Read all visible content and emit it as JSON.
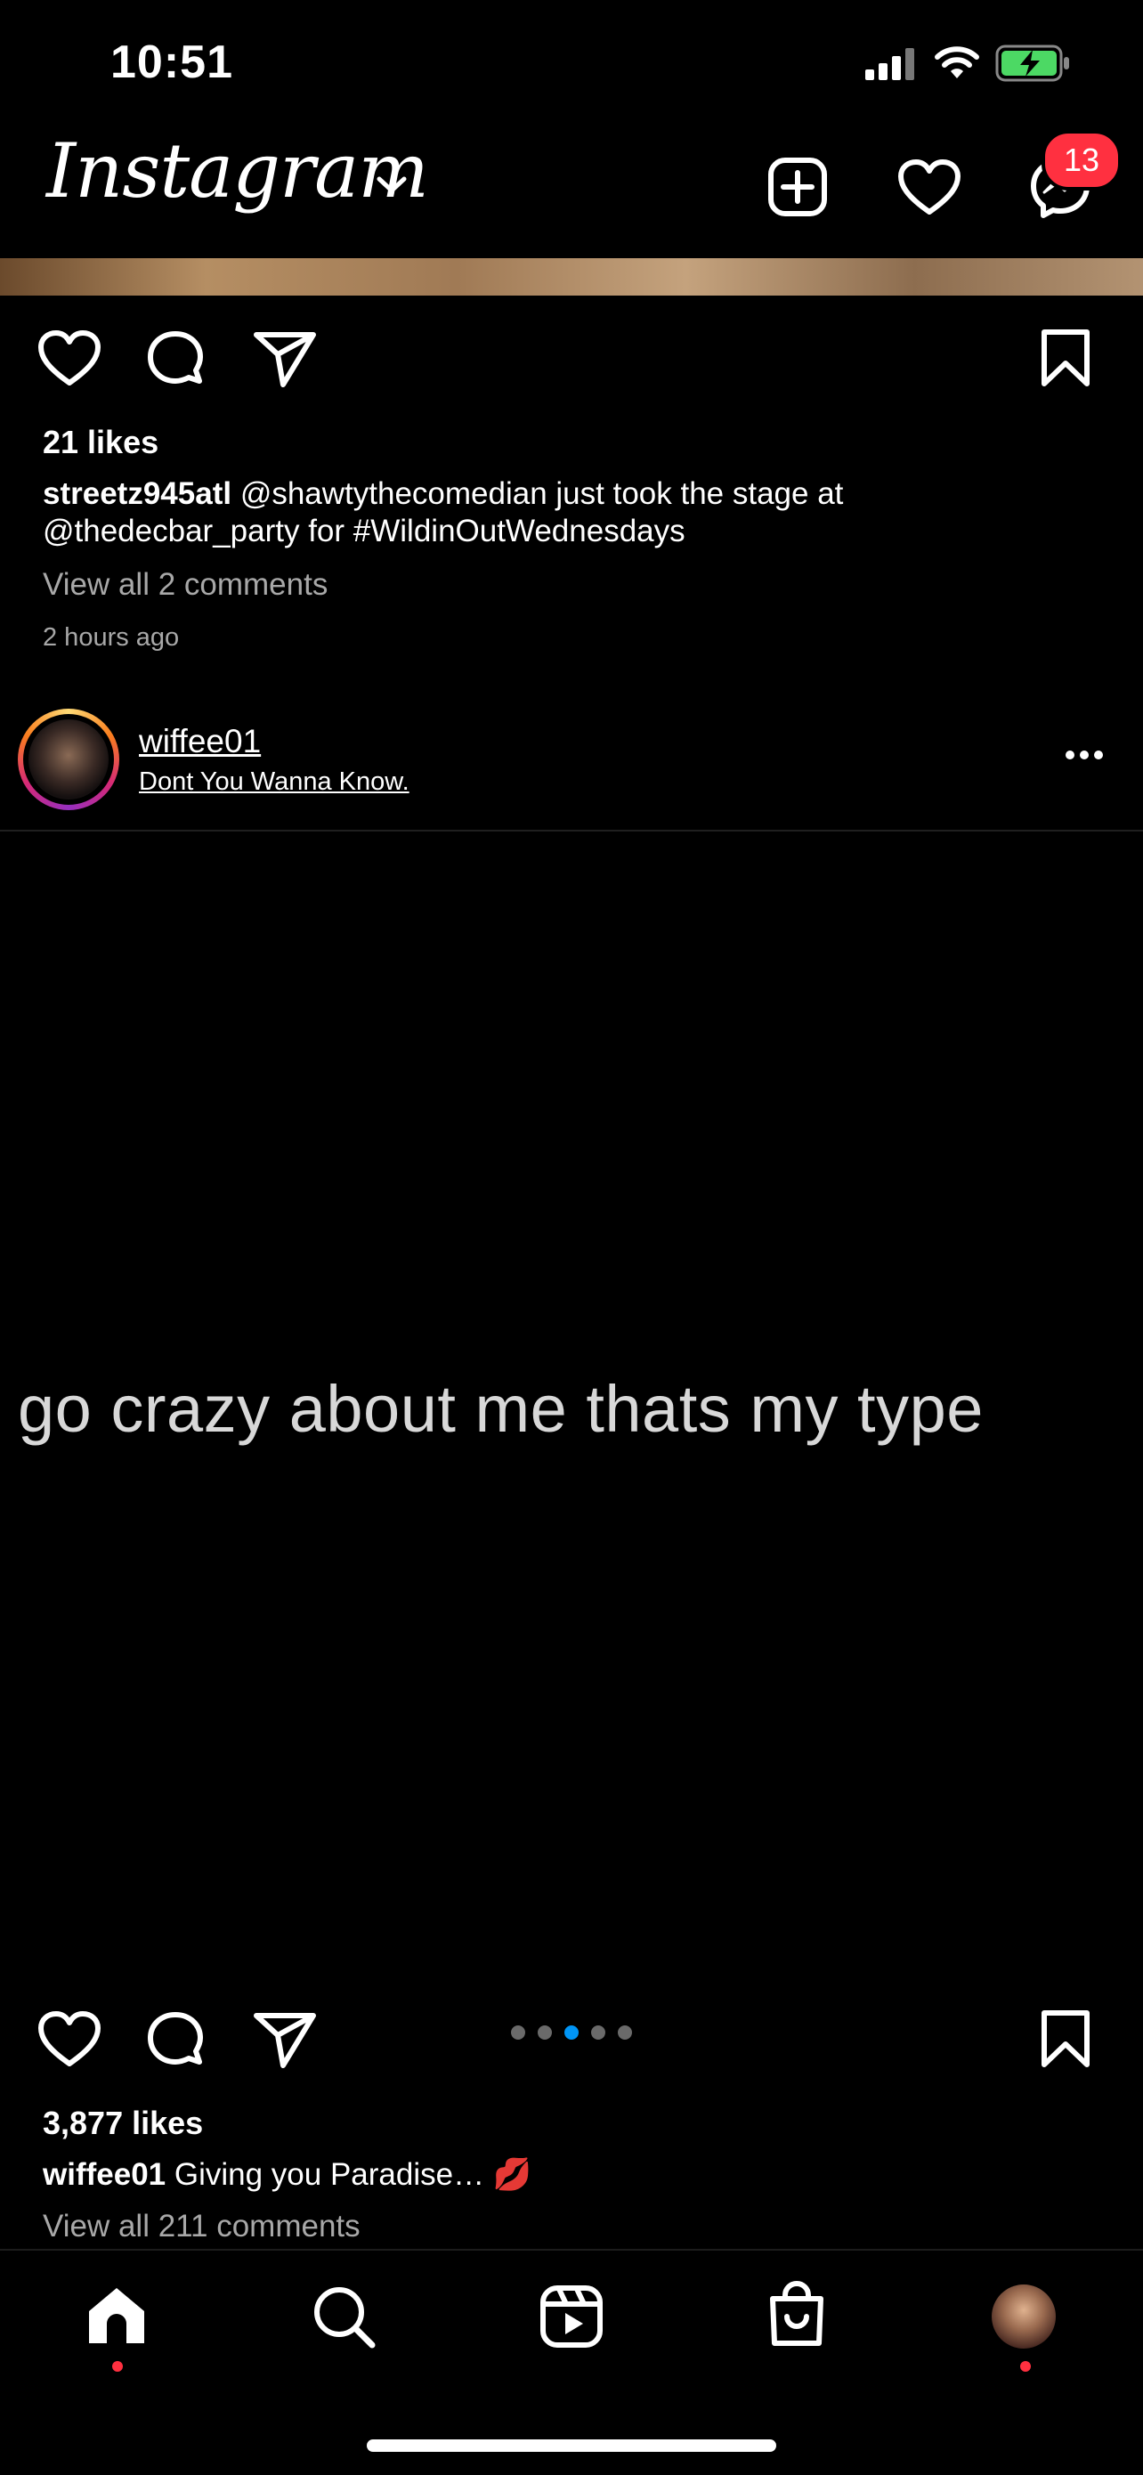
{
  "status_bar": {
    "time": "10:51"
  },
  "header": {
    "logo": "Instagram",
    "messenger_badge": "13",
    "icons": [
      "chevron-down-icon",
      "new-post-icon",
      "heart-icon",
      "messenger-icon"
    ]
  },
  "post1": {
    "likes": "21 likes",
    "username": "streetz945atl",
    "caption_line1": "@shawtythecomedian just took the stage at",
    "caption_line2": "@thedecbar_party for #WildinOutWednesdays",
    "view_comments": "View all 2 comments",
    "time": "2 hours ago"
  },
  "post2": {
    "username": "wiffee01",
    "audio": "Dont You Wanna Know.",
    "image_text": "go crazy about me thats my type",
    "carousel": {
      "count": 5,
      "active": 3
    },
    "likes": "3,877 likes",
    "caption_user": "wiffee01",
    "caption_text": "Giving you Paradise… 💋",
    "view_comments": "View all 211 comments"
  },
  "colors": {
    "accent_blue": "#0095f6",
    "badge_red": "#ff3040"
  },
  "nav": [
    "home-icon",
    "search-icon",
    "reels-icon",
    "shop-icon",
    "profile-avatar"
  ]
}
